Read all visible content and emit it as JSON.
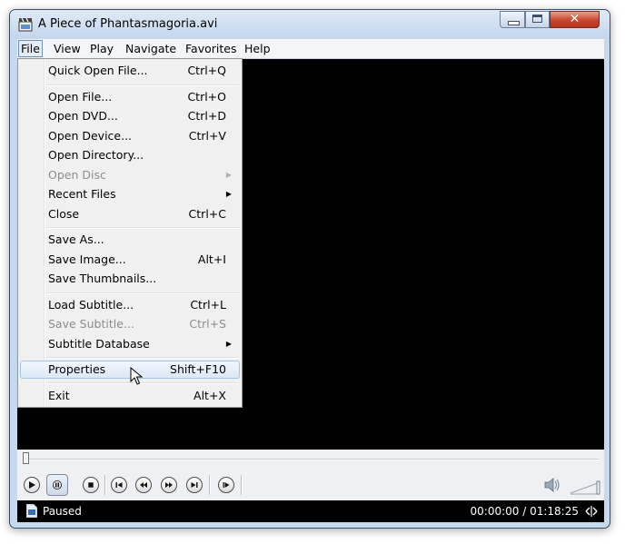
{
  "window": {
    "title": "A Piece of Phantasmagoria.avi",
    "close_glyph": "✕"
  },
  "menubar": [
    "File",
    "View",
    "Play",
    "Navigate",
    "Favorites",
    "Help"
  ],
  "file_menu": {
    "quick_open": {
      "label": "Quick Open File...",
      "shortcut": "Ctrl+Q"
    },
    "open_file": {
      "label": "Open File...",
      "shortcut": "Ctrl+O"
    },
    "open_dvd": {
      "label": "Open DVD...",
      "shortcut": "Ctrl+D"
    },
    "open_device": {
      "label": "Open Device...",
      "shortcut": "Ctrl+V"
    },
    "open_directory": {
      "label": "Open Directory..."
    },
    "open_disc": {
      "label": "Open Disc",
      "disabled": true,
      "submenu": true
    },
    "recent_files": {
      "label": "Recent Files",
      "submenu": true
    },
    "close": {
      "label": "Close",
      "shortcut": "Ctrl+C"
    },
    "save_as": {
      "label": "Save As..."
    },
    "save_image": {
      "label": "Save Image...",
      "shortcut": "Alt+I"
    },
    "save_thumbnails": {
      "label": "Save Thumbnails..."
    },
    "load_subtitle": {
      "label": "Load Subtitle...",
      "shortcut": "Ctrl+L"
    },
    "save_subtitle": {
      "label": "Save Subtitle...",
      "shortcut": "Ctrl+S",
      "disabled": true
    },
    "subtitle_database": {
      "label": "Subtitle Database",
      "submenu": true
    },
    "properties": {
      "label": "Properties",
      "shortcut": "Shift+F10",
      "highlighted": true
    },
    "exit": {
      "label": "Exit",
      "shortcut": "Alt+X"
    },
    "submenu_arrow": "▶"
  },
  "playback": {
    "position_fraction": 0.0
  },
  "status": {
    "state": "Paused",
    "time": "00:00:00 / 01:18:25"
  },
  "icons": {
    "title": "film-clapper-icon",
    "play": "play-icon",
    "pause": "pause-icon",
    "stop": "stop-icon",
    "skip_back": "skip-back-icon",
    "rewind": "rewind-icon",
    "forward": "fast-forward-icon",
    "skip_forward": "skip-forward-icon",
    "frame_step": "frame-step-icon",
    "volume": "speaker-icon"
  },
  "colors": {
    "video": "#000000",
    "highlight": "#dbe8f7",
    "disabled": "#8d8d8d"
  }
}
